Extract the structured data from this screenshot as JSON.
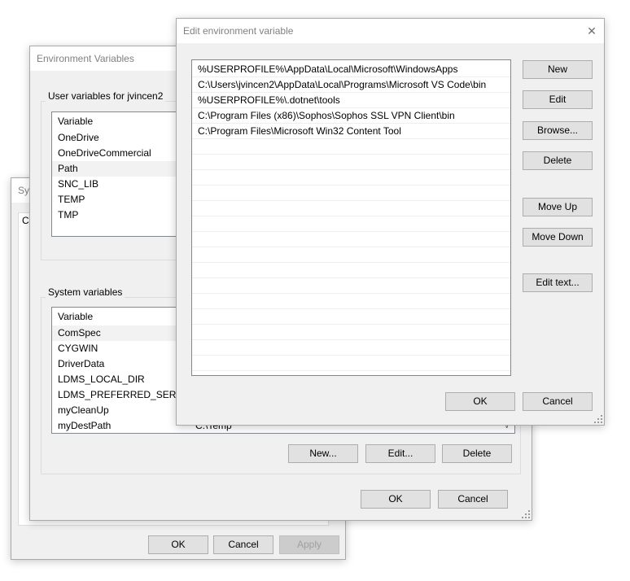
{
  "system_properties": {
    "title": "Sys",
    "tab_label": "Co",
    "buttons": {
      "ok": "OK",
      "cancel": "Cancel",
      "apply": "Apply"
    }
  },
  "env_vars": {
    "title": "Environment Variables",
    "user_group_label": "User variables for jvincen2",
    "user_header": "Variable",
    "user_vars": [
      "OneDrive",
      "OneDriveCommercial",
      "Path",
      "SNC_LIB",
      "TEMP",
      "TMP"
    ],
    "system_group_label": "System variables",
    "system_header": "Variable",
    "system_vars": [
      "ComSpec",
      "CYGWIN",
      "DriverData",
      "LDMS_LOCAL_DIR",
      "LDMS_PREFERRED_SERVER",
      "myCleanUp",
      "myDestPath"
    ],
    "system_last_value": "C:\\Temp",
    "system_buttons": {
      "new": "New...",
      "edit": "Edit...",
      "delete": "Delete"
    },
    "buttons": {
      "ok": "OK",
      "cancel": "Cancel"
    }
  },
  "edit_dialog": {
    "title": "Edit environment variable",
    "close_glyph": "✕",
    "paths": [
      "%USERPROFILE%\\AppData\\Local\\Microsoft\\WindowsApps",
      "C:\\Users\\jvincen2\\AppData\\Local\\Programs\\Microsoft VS Code\\bin",
      "%USERPROFILE%\\.dotnet\\tools",
      "C:\\Program Files (x86)\\Sophos\\Sophos SSL VPN Client\\bin",
      "C:\\Program Files\\Microsoft Win32 Content Tool"
    ],
    "side_buttons": {
      "new": "New",
      "edit": "Edit",
      "browse": "Browse...",
      "delete": "Delete",
      "move_up": "Move Up",
      "move_down": "Move Down",
      "edit_text": "Edit text..."
    },
    "buttons": {
      "ok": "OK",
      "cancel": "Cancel"
    }
  },
  "colors": {
    "window_bg": "#f0f0f0",
    "button_bg": "#e1e1e1",
    "border": "#adadad",
    "focus": "#0078d7"
  }
}
